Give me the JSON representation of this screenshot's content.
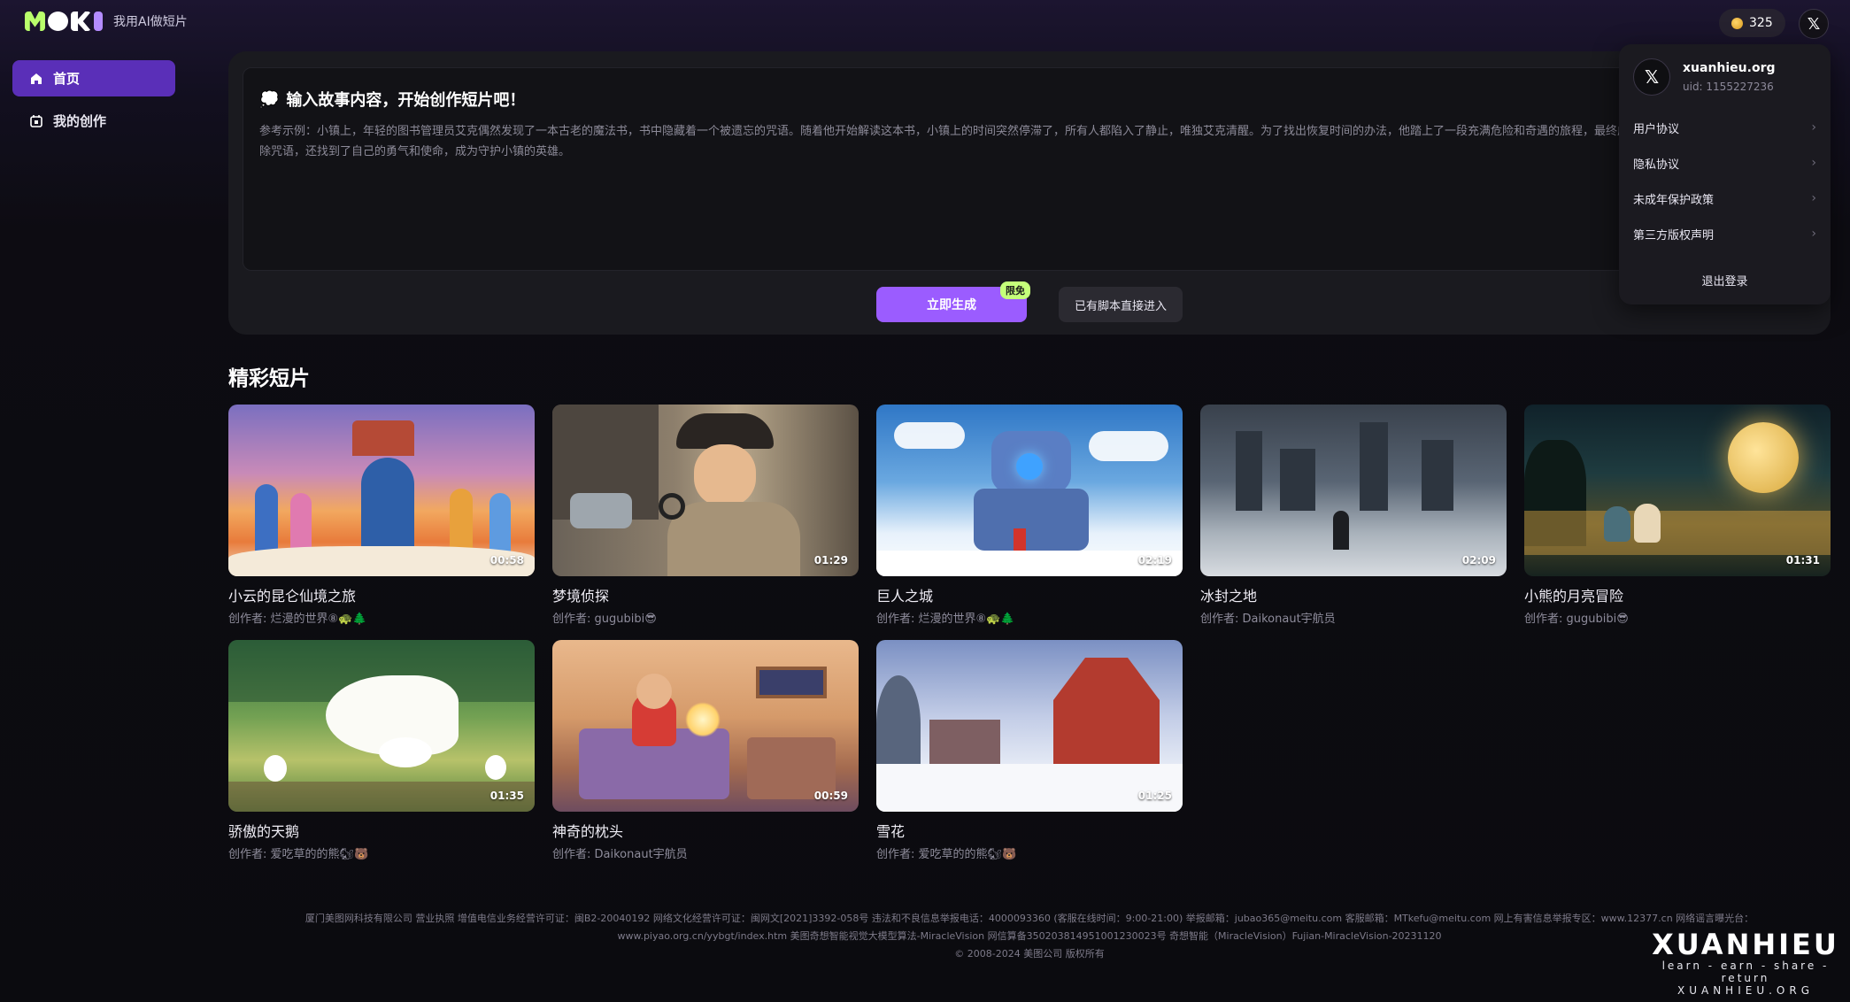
{
  "brand": {
    "logo": "MOKI",
    "slogan": "我用AI做短片"
  },
  "header": {
    "coins": "325",
    "avatar_glyph": "𝕏"
  },
  "sidebar": {
    "items": [
      {
        "label": "首页",
        "icon": "home-icon"
      },
      {
        "label": "我的创作",
        "icon": "creation-icon"
      }
    ]
  },
  "composer": {
    "title": "输入故事内容，开始创作短片吧！",
    "placeholder": "参考示例：小镇上，年轻的图书管理员艾克偶然发现了一本古老的魔法书，书中隐藏着一个被遗忘的咒语。随着他开始解读这本书，小镇上的时间突然停滞了，所有人都陷入了静止，唯独艾克清醒。为了找出恢复时间的办法，他踏上了一段充满危险和奇遇的旅程，最终成功解除咒语，还找到了自己的勇气和使命，成为守护小镇的英雄。",
    "generate_label": "立即生成",
    "free_tag": "限免",
    "script_label": "已有脚本直接进入"
  },
  "section": {
    "title": "精彩短片"
  },
  "videos": [
    {
      "title": "小云的昆仑仙境之旅",
      "author": "创作者: 烂漫的世界⑧🐢🌲",
      "duration": "00:58"
    },
    {
      "title": "梦境侦探",
      "author": "创作者: gugubibi😎",
      "duration": "01:29"
    },
    {
      "title": "巨人之城",
      "author": "创作者: 烂漫的世界⑧🐢🌲",
      "duration": "02:19"
    },
    {
      "title": "冰封之地",
      "author": "创作者: Daikonaut宇航员",
      "duration": "02:09"
    },
    {
      "title": "小熊的月亮冒险",
      "author": "创作者: gugubibi😎",
      "duration": "01:31"
    },
    {
      "title": "骄傲的天鹅",
      "author": "创作者: 爱吃草的的熊🐿🐻",
      "duration": "01:35"
    },
    {
      "title": "神奇的枕头",
      "author": "创作者: Daikonaut宇航员",
      "duration": "00:59"
    },
    {
      "title": "雪花",
      "author": "创作者: 爱吃草的的熊🐿🐻",
      "duration": "01:25"
    }
  ],
  "dropdown": {
    "name": "xuanhieu.org",
    "uid": "uid: 1155227236",
    "items": [
      "用户协议",
      "隐私协议",
      "未成年保护政策",
      "第三方版权声明"
    ],
    "logout": "退出登录"
  },
  "footer": {
    "line1": "厦门美图网科技有限公司 营业执照 增值电信业务经营许可证：闽B2-20040192 网络文化经营许可证：闽网文[2021]3392-058号 违法和不良信息举报电话：4000093360 (客服在线时间：9:00-21:00) 举报邮箱：jubao365@meitu.com 客服邮箱：MTkefu@meitu.com 网上有害信息举报专区：www.12377.cn 网络谣言曝光台：",
    "line2": "www.piyao.org.cn/yybgt/index.htm 美图奇想智能视觉大模型算法-MiracleVision 网信算备350203814951001230023号 奇想智能（MiracleVision）Fujian-MiracleVision-20231120",
    "line3": "© 2008-2024 美图公司 版权所有"
  },
  "watermark": {
    "big": "XUANHIEU",
    "small": "learn - earn - share - return",
    "url": "XUANHIEU.ORG"
  }
}
